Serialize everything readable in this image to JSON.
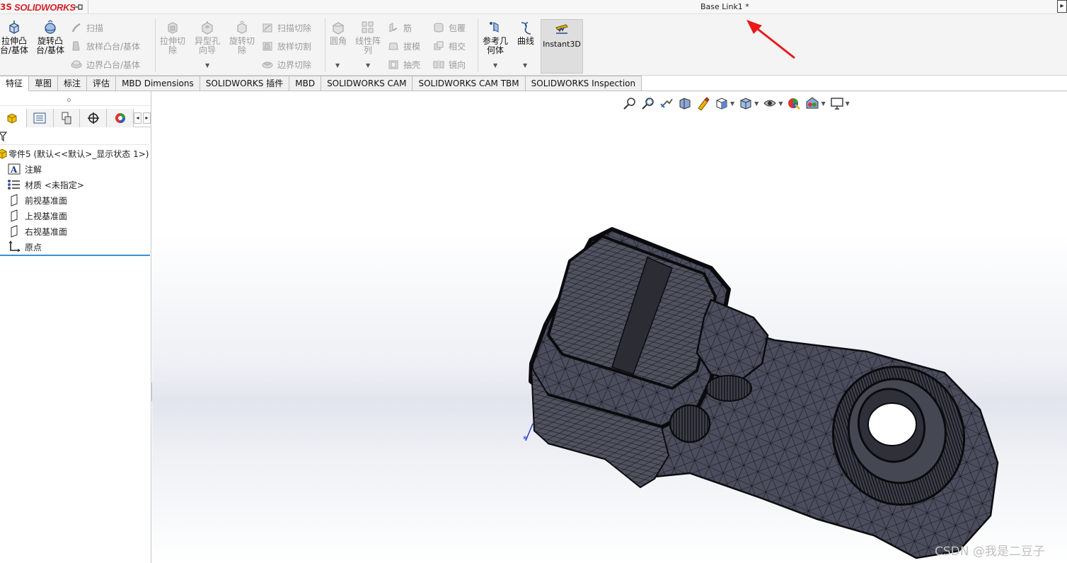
{
  "app": {
    "brand_prefix": "3S",
    "brand_name_a": "SOLID",
    "brand_name_b": "WORKS",
    "document_title": "Base Link1 *",
    "window_button": "▸"
  },
  "colors": {
    "brand_red": "#d2232a",
    "accent_blue": "#3c8fd0",
    "model_fill": "#4b4d5c",
    "annotation_red": "#e8191a"
  },
  "ribbon": {
    "extrude_boss_line1": "拉伸凸",
    "extrude_boss_line2": "台/基体",
    "revolve_boss_line1": "旋转凸",
    "revolve_boss_line2": "台/基体",
    "sweep": "扫描",
    "loft_boss": "放样凸台/基体",
    "boundary_boss": "边界凸台/基体",
    "extrude_cut_line1": "拉伸切",
    "extrude_cut_line2": "除",
    "hole_wizard_line1": "异型孔",
    "hole_wizard_line2": "向导",
    "revolve_cut_line1": "旋转切",
    "revolve_cut_line2": "除",
    "swept_cut": "扫描切除",
    "lofted_cut": "放样切割",
    "boundary_cut": "边界切除",
    "fillet": "圆角",
    "linear_pattern_line1": "线性阵",
    "linear_pattern_line2": "列",
    "rib": "筋",
    "draft": "拔模",
    "shell": "抽壳",
    "wrap": "包覆",
    "intersect": "相交",
    "mirror": "镜向",
    "ref_geometry_line1": "参考几",
    "ref_geometry_line2": "何体",
    "curves": "曲线",
    "instant3d": "Instant3D"
  },
  "tabs": [
    {
      "label": "特征",
      "active": true
    },
    {
      "label": "草图",
      "active": false
    },
    {
      "label": "标注",
      "active": false
    },
    {
      "label": "评估",
      "active": false
    },
    {
      "label": "MBD Dimensions",
      "active": false
    },
    {
      "label": "SOLIDWORKS 插件",
      "active": false
    },
    {
      "label": "MBD",
      "active": false
    },
    {
      "label": "SOLIDWORKS CAM",
      "active": false
    },
    {
      "label": "SOLIDWORKS CAM TBM",
      "active": false
    },
    {
      "label": "SOLIDWORKS Inspection",
      "active": false
    }
  ],
  "tree": {
    "root": "零件5  (默认<<默认>_显示状态 1>)",
    "items": [
      {
        "label": "注解",
        "icon": "annotation-icon"
      },
      {
        "label": "材质 <未指定>",
        "icon": "material-icon"
      },
      {
        "label": "前视基准面",
        "icon": "plane-icon"
      },
      {
        "label": "上视基准面",
        "icon": "plane-icon"
      },
      {
        "label": "右视基准面",
        "icon": "plane-icon"
      },
      {
        "label": "原点",
        "icon": "origin-icon"
      }
    ]
  },
  "watermark": "CSDN @我是二豆子"
}
